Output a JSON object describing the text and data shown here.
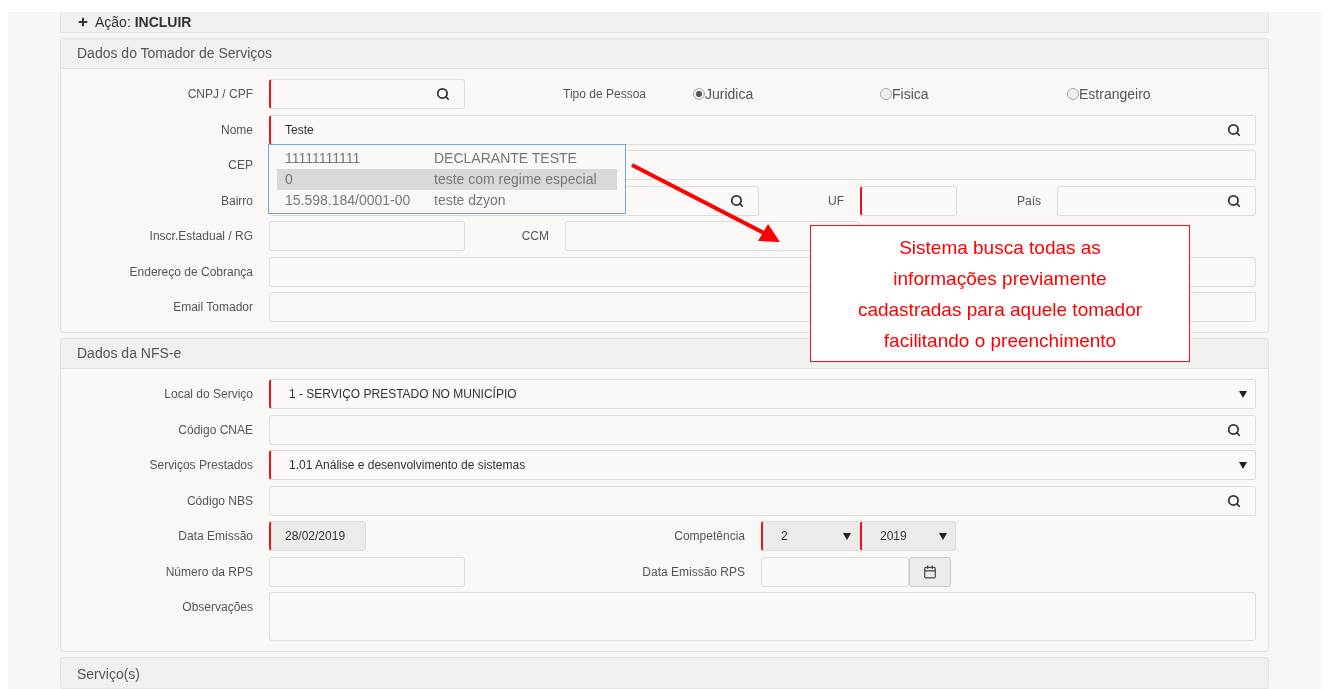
{
  "action": {
    "label": "Ação:",
    "value": "INCLUIR"
  },
  "tomador": {
    "title": "Dados do Tomador de Serviços",
    "cnpj": {
      "label": "CNPJ / CPF",
      "required": true
    },
    "tipo_pessoa": {
      "label": "Tipo de Pessoa",
      "options": [
        {
          "label": "Juridica",
          "selected": true
        },
        {
          "label": "Fisica",
          "selected": false
        },
        {
          "label": "Estrangeiro",
          "selected": false
        }
      ]
    },
    "nome": {
      "label": "Nome",
      "value": "Teste",
      "required": true
    },
    "suggestions": [
      {
        "code": "11111111111",
        "name": "DECLARANTE TESTE",
        "selected": false
      },
      {
        "code": "0",
        "name": "teste com regime especial",
        "selected": true
      },
      {
        "code": "15.598.184/0001-00",
        "name": "teste dzyon",
        "selected": false
      }
    ],
    "cep": {
      "label": "CEP"
    },
    "bairro": {
      "label": "Bairro"
    },
    "uf": {
      "label": "UF",
      "required": true
    },
    "pais": {
      "label": "País"
    },
    "inscricao": {
      "label": "Inscr.Estadual / RG"
    },
    "ccm": {
      "label": "CCM"
    },
    "endereco_cobranca": {
      "label": "Endereço de Cobrança"
    },
    "email": {
      "label": "Email Tomador"
    }
  },
  "callout": {
    "text": "Sistema busca todas as informações previamente cadastradas para aquele tomador facilitando o preenchimento"
  },
  "nfse": {
    "title": "Dados da NFS-e",
    "local": {
      "label": "Local do Serviço",
      "value": "1 - SERVIÇO PRESTADO NO MUNICÍPIO",
      "required": true
    },
    "cnae": {
      "label": "Código CNAE"
    },
    "servicos": {
      "label": "Serviços Prestados",
      "value": "1.01 Análise e desenvolvimento de sistemas",
      "required": true
    },
    "nbs": {
      "label": "Código NBS"
    },
    "data_emissao": {
      "label": "Data Emissão",
      "value": "28/02/2019",
      "required": true
    },
    "competencia": {
      "label": "Competência",
      "month": "2",
      "year": "2019",
      "required": true
    },
    "numero_rps": {
      "label": "Número da RPS"
    },
    "data_emissao_rps": {
      "label": "Data Emissão RPS"
    },
    "observacoes": {
      "label": "Observações"
    }
  },
  "servicos_section": {
    "title": "Serviço(s)"
  }
}
